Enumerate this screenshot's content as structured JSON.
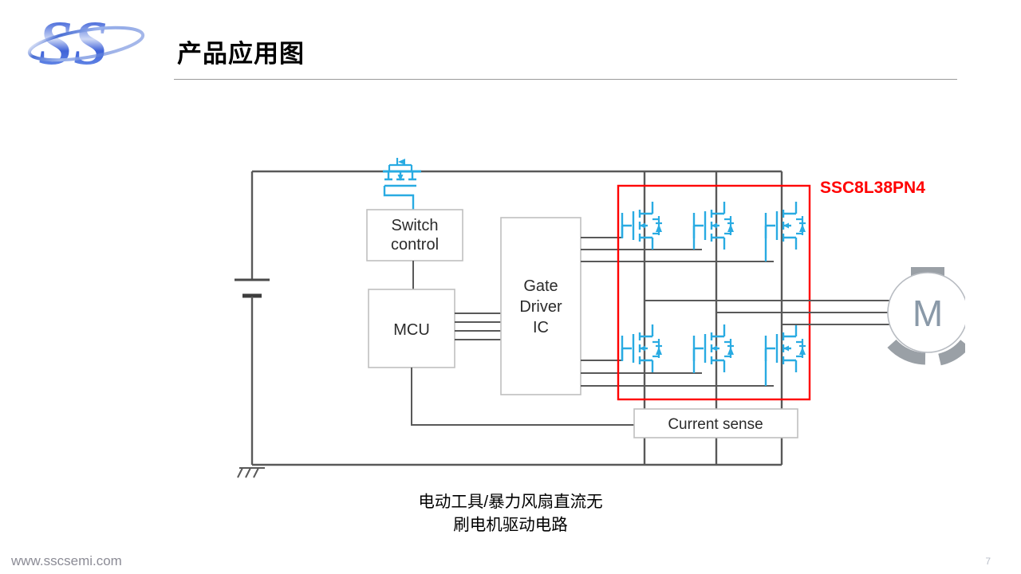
{
  "header": {
    "title": "产品应用图",
    "logo_text": "SS",
    "logo_color": "#4a6fd4"
  },
  "diagram": {
    "blocks": [
      {
        "id": "switch-control",
        "label_lines": [
          "Switch",
          "control"
        ]
      },
      {
        "id": "mcu",
        "label_lines": [
          "MCU"
        ]
      },
      {
        "id": "gate-driver-ic",
        "label_lines": [
          "Gate",
          "Driver",
          "IC"
        ]
      },
      {
        "id": "current-sense",
        "label_lines": [
          "Current sense"
        ]
      }
    ],
    "motor_label": "M",
    "highlight_label": "SSC8L38PN4",
    "highlight_color": "#ff0000",
    "mosfet_color": "#29abe2",
    "wire_color": "#595959",
    "block_border_color": "#bfbfbf",
    "mosfet_count_bridge": 6,
    "mosfet_count_reverse_protect": 1,
    "phase_wire_count": 3,
    "mcu_to_driver_bus_lines": 4,
    "battery_symbol": "dc-source",
    "ground_symbol": "chassis-ground"
  },
  "caption": {
    "line1": "电动工具/暴力风扇直流无",
    "line2": "刷电机驱动电路"
  },
  "footer": {
    "url": "www.sscsemi.com",
    "page_number": "7"
  }
}
